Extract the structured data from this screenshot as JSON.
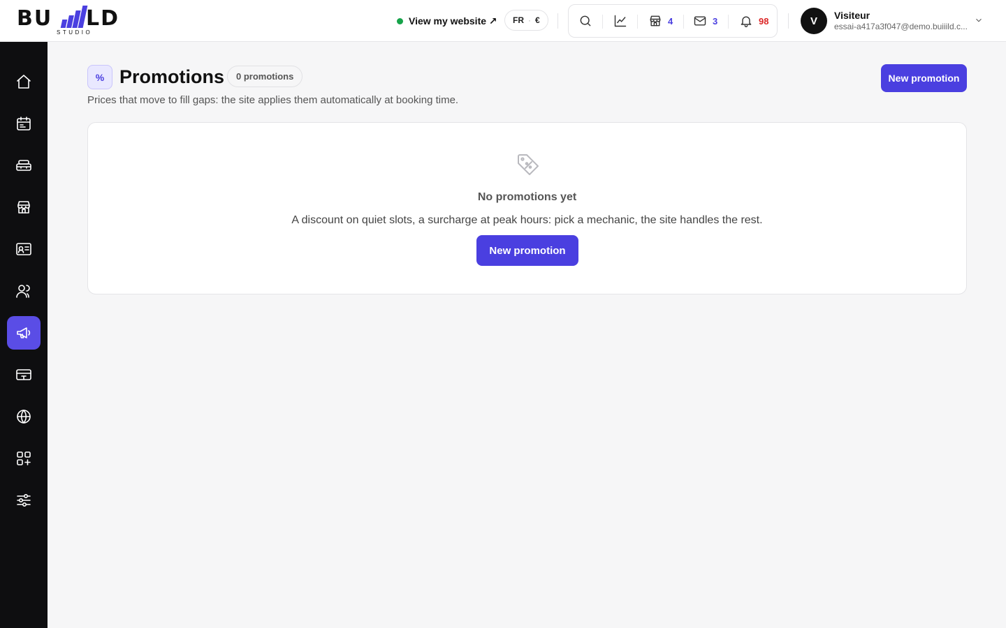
{
  "brand": {
    "word_left": "BU",
    "word_right": "LD",
    "sub": "STUDIO",
    "accent": "#4a3fe0"
  },
  "header": {
    "view_site_label": "View my website ↗",
    "lang": "FR",
    "currency": "€",
    "tools": [
      {
        "icon": "search-icon",
        "count": ""
      },
      {
        "icon": "chart-icon",
        "count": ""
      },
      {
        "icon": "store-icon",
        "count": "4",
        "color": "#4a3fe0"
      },
      {
        "icon": "mail-icon",
        "count": "3",
        "color": "#4a3fe0"
      },
      {
        "icon": "bell-icon",
        "count": "98",
        "color": "#dc2626"
      }
    ],
    "user": {
      "initial": "V",
      "name": "Visiteur",
      "email": "essai-a417a3f047@demo.buiiild.c..."
    }
  },
  "sidebar": {
    "items": [
      {
        "icon": "home-icon",
        "active": false
      },
      {
        "icon": "calendar-icon",
        "active": false
      },
      {
        "icon": "services-icon",
        "active": false
      },
      {
        "icon": "store-icon",
        "active": false
      },
      {
        "icon": "id-card-icon",
        "active": false
      },
      {
        "icon": "users-icon",
        "active": false
      },
      {
        "icon": "megaphone-icon",
        "active": true
      },
      {
        "icon": "payment-icon",
        "active": false
      },
      {
        "icon": "globe-icon",
        "active": false
      },
      {
        "icon": "apps-icon",
        "active": false
      },
      {
        "icon": "settings-sliders-icon",
        "active": false
      }
    ]
  },
  "main": {
    "icon_glyph": "%",
    "title": "Promotions",
    "count_label": "0 promotions",
    "subtitle": "Prices that move to fill gaps: the site applies them automatically at booking time.",
    "new_button": "New promotion",
    "empty": {
      "icon": "tag-percent-icon",
      "title": "No promotions yet",
      "text": "A discount on quiet slots, a surcharge at peak hours: pick a mechanic, the site handles the rest.",
      "button": "New promotion"
    }
  }
}
